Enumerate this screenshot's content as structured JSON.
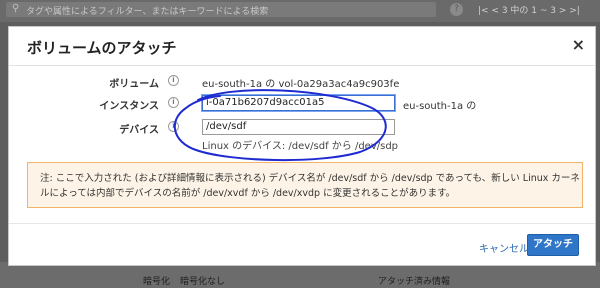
{
  "background": {
    "search_placeholder": "タグや属性によるフィルター、またはキーワードによる検索",
    "help_icon": "?",
    "pager_text": "|< < 3 中の 1 ~ 3 > >|",
    "bottom_labels": [
      "暗号化",
      "暗号化なし",
      "アタッチ済み情報"
    ]
  },
  "modal": {
    "title": "ボリュームのアタッチ",
    "close_icon": "×",
    "volume_label": "ボリューム",
    "volume_value": "eu-south-1a の vol-0a29a3ac4a9c903fe",
    "instance_label": "インスタンス",
    "instance_value": "i-0a71b6207d9acc01a5",
    "instance_suffix": "eu-south-1a の",
    "device_label": "デバイス",
    "device_value": "/dev/sdf",
    "device_hint": "Linux のデバイス: /dev/sdf から /dev/sdp",
    "info_icon": "i",
    "note": "注: ここで入力された (および詳細情報に表示される) デバイス名が /dev/sdf から /dev/sdp であっても、新しい Linux カーネルによっては内部でデバイスの名前が /dev/xvdf から /dev/xvdp に変更されることがあります。",
    "cancel_label": "キャンセル",
    "attach_label": "アタッチ"
  },
  "colors": {
    "accent": "#2f76c9",
    "annotation": "#1f2bd1",
    "warning_border": "#f2b46a",
    "warning_bg": "#fdf4e7"
  }
}
